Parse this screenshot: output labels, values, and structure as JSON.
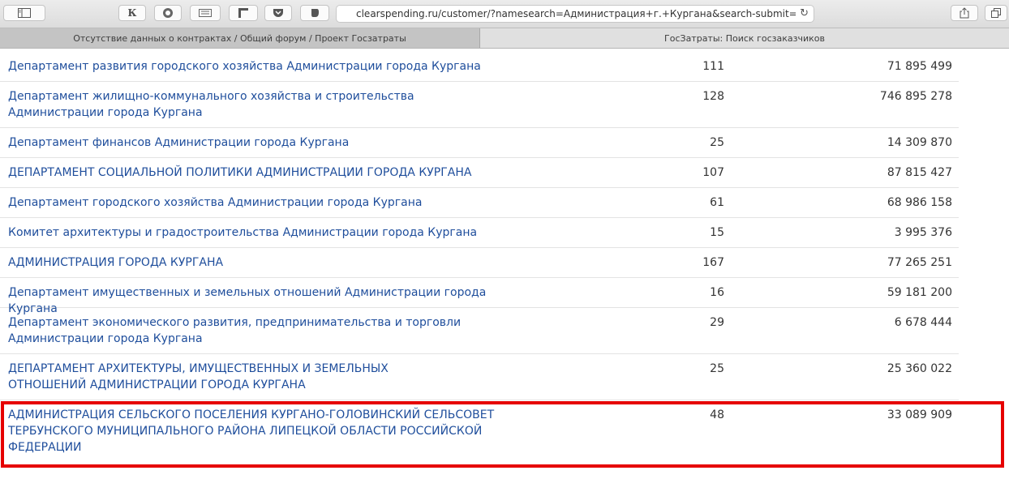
{
  "browser": {
    "url": "clearspending.ru/customer/?namesearch=Администрация+г.+Кургана&search-submit=&regi",
    "toolbar_icons": [
      "sidebar-icon",
      "kinopoisk-icon",
      "shield-icon",
      "keyboard-icon",
      "corner-icon",
      "pocket-icon",
      "evernote-icon",
      "reload-icon",
      "share-icon",
      "tabs-icon"
    ],
    "k_label": "К"
  },
  "tabs": [
    {
      "label": "Отсутствие данных о контрактах / Общий форум / Проект Госзатраты"
    },
    {
      "label": "ГосЗатраты: Поиск госзаказчиков"
    }
  ],
  "rows": [
    {
      "name": "Департамент развития городского хозяйства Администрации города Кургана",
      "count": "111",
      "amount": "71 895 499"
    },
    {
      "name": "Департамент жилищно-коммунального хозяйства и строительства Администрации города Кургана",
      "count": "128",
      "amount": "746 895 278"
    },
    {
      "name": "Департамент финансов Администрации города Кургана",
      "count": "25",
      "amount": "14 309 870"
    },
    {
      "name": "ДЕПАРТАМЕНТ СОЦИАЛЬНОЙ ПОЛИТИКИ АДМИНИСТРАЦИИ ГОРОДА КУРГАНА",
      "count": "107",
      "amount": "87 815 427"
    },
    {
      "name": "Департамент городского хозяйства Администрации города Кургана",
      "count": "61",
      "amount": "68 986 158"
    },
    {
      "name": "Комитет архитектуры и градостроительства Администрации города Кургана",
      "count": "15",
      "amount": "3 995 376"
    },
    {
      "name": "АДМИНИСТРАЦИЯ ГОРОДА КУРГАНА",
      "count": "167",
      "amount": "77 265 251"
    },
    {
      "name": "Департамент имущественных и земельных отношений Администрации города Кургана",
      "count": "16",
      "amount": "59 181 200"
    },
    {
      "name": "Департамент экономического развития, предпринимательства и торговли Администрации города Кургана",
      "count": "29",
      "amount": "6 678 444"
    },
    {
      "name": "ДЕПАРТАМЕНТ АРХИТЕКТУРЫ, ИМУЩЕСТВЕННЫХ И ЗЕМЕЛЬНЫХ ОТНОШЕНИЙ АДМИНИСТРАЦИИ ГОРОДА КУРГАНА",
      "count": "25",
      "amount": "25 360 022"
    },
    {
      "name": "АДМИНИСТРАЦИЯ СЕЛЬСКОГО ПОСЕЛЕНИЯ КУРГАНО-ГОЛОВИНСКИЙ СЕЛЬСОВЕТ ТЕРБУНСКОГО МУНИЦИПАЛЬНОГО РАЙОНА ЛИПЕЦКОЙ ОБЛАСТИ РОССИЙСКОЙ ФЕДЕРАЦИИ",
      "count": "48",
      "amount": "33 089 909"
    }
  ],
  "highlight_color": "#e60000",
  "link_color": "#1f4e9c"
}
